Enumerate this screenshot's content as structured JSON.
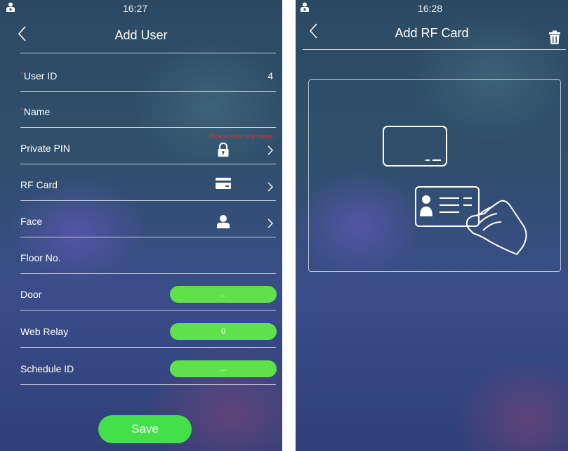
{
  "left_screen": {
    "status_bar": {
      "time": "16:27",
      "icon": "user-icon"
    },
    "nav": {
      "back_icon": "chevron-left-icon",
      "title": "Add User"
    },
    "form": {
      "required_mark": "*",
      "user_id": {
        "label": "User ID",
        "value": "4",
        "required": true
      },
      "name": {
        "label": "Name",
        "value": "",
        "required": true,
        "error": "Please enter the name."
      },
      "private_pin": {
        "label": "Private PIN",
        "icon": "lock-icon"
      },
      "rf_card": {
        "label": "RF Card",
        "icon": "card-icon"
      },
      "face": {
        "label": "Face",
        "icon": "person-icon"
      },
      "floor_no": {
        "label": "Floor No.",
        "value": ""
      },
      "door": {
        "label": "Door",
        "value": "..."
      },
      "web_relay": {
        "label": "Web Relay",
        "value": "0"
      },
      "schedule_id": {
        "label": "Schedule ID",
        "value": "..."
      }
    },
    "save_label": "Save"
  },
  "right_screen": {
    "status_bar": {
      "time": "16:28",
      "icon": "user-icon"
    },
    "nav": {
      "back_icon": "chevron-left-icon",
      "title": "Add RF Card",
      "action_icon": "trash-icon"
    },
    "illustration": "tap-card-icon"
  },
  "colors": {
    "accent_green": "#5fe04c",
    "error_red": "#d83232",
    "required_red": "#e43a3a",
    "text": "#ffffff"
  }
}
